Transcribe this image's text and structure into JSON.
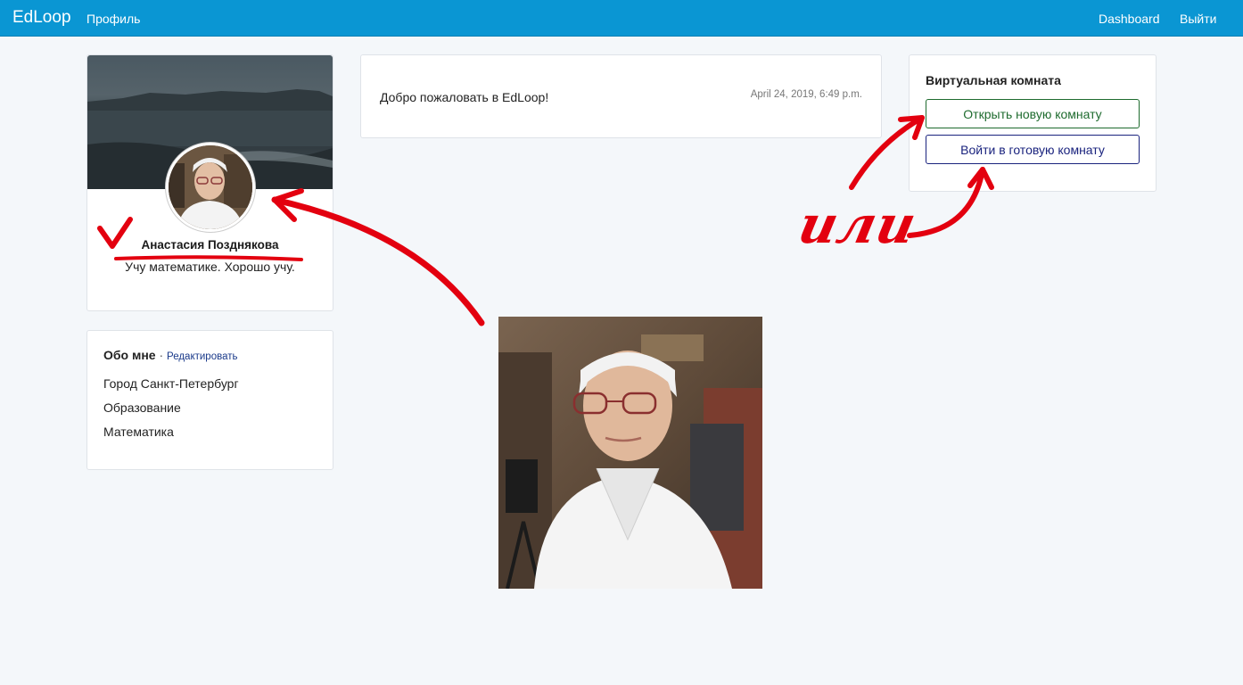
{
  "navbar": {
    "brand": "EdLoop",
    "profile_link": "Профиль",
    "dashboard_link": "Dashboard",
    "logout_link": "Выйти",
    "color": "#0a96d3"
  },
  "profile": {
    "name": "Анастасия Позднякова",
    "bio": "Учу математике. Хорошо учу."
  },
  "about": {
    "title": "Обо мне",
    "separator": "·",
    "edit_link": "Редактировать",
    "items": [
      "Город Санкт-Петербург",
      "Образование",
      "Математика"
    ]
  },
  "feed": {
    "message": "Добро пожаловать в EdLoop!",
    "timestamp": "April 24, 2019, 6:49 p.m."
  },
  "room": {
    "title": "Виртуальная комната",
    "open_button": "Открыть новую комнату",
    "join_button": "Войти в готовую комнату",
    "open_color": "#1e6b2e",
    "join_color": "#1a237e"
  },
  "annotation": {
    "word": "или",
    "color": "#e3000f"
  }
}
